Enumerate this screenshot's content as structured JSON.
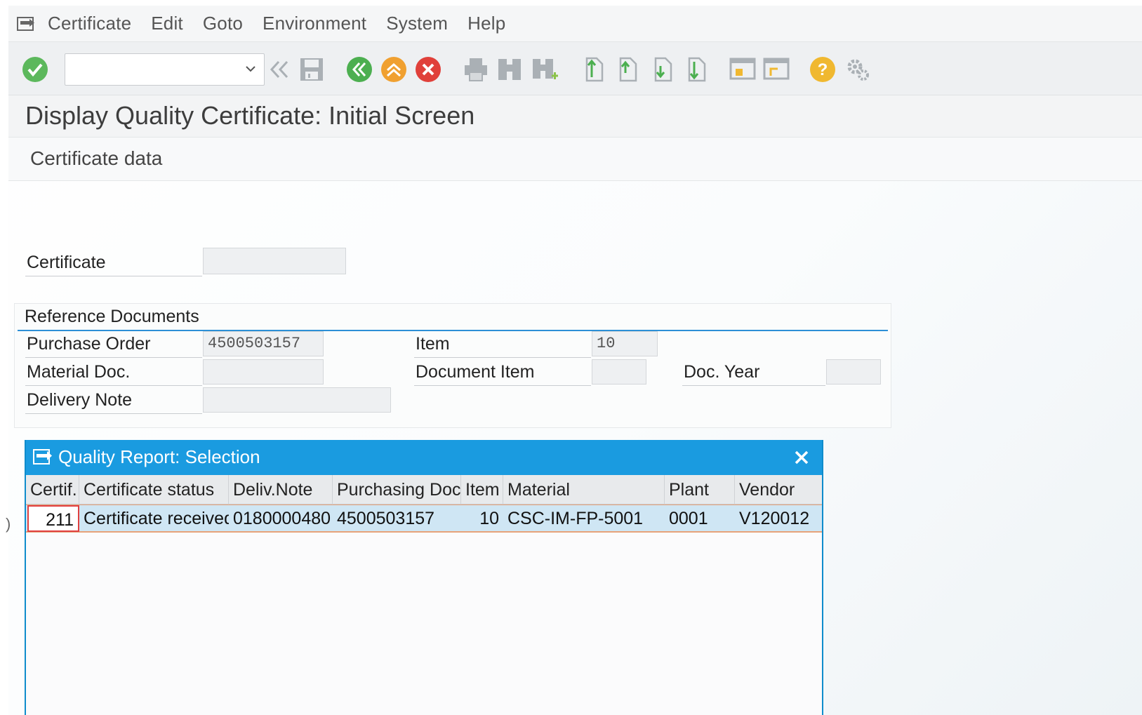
{
  "menu": {
    "items": [
      "Certificate",
      "Edit",
      "Goto",
      "Environment",
      "System",
      "Help"
    ]
  },
  "toolbar": {
    "command_value": "",
    "icons": [
      "enter-icon",
      "command-dropdown",
      "back-double-icon",
      "save-icon",
      "back-icon",
      "exit-icon",
      "cancel-icon",
      "print-icon",
      "find-icon",
      "find-next-icon",
      "first-page-icon",
      "previous-page-icon",
      "next-page-icon",
      "last-page-icon",
      "create-session-icon",
      "create-shortcut-icon",
      "help-icon",
      "customize-layout-icon"
    ],
    "colors": {
      "enter": "#5cb85c",
      "back": "#4caf50",
      "exit": "#f0a030",
      "cancel": "#e0403a",
      "help": "#f0b830"
    }
  },
  "page": {
    "title": "Display Quality Certificate: Initial Screen",
    "section": "Certificate data"
  },
  "form": {
    "certificate_label": "Certificate",
    "certificate_value": "",
    "reference_title": "Reference Documents",
    "purchase_order_label": "Purchase Order",
    "purchase_order_value": "4500503157",
    "item_label": "Item",
    "item_value": "10",
    "material_doc_label": "Material Doc.",
    "material_doc_value": "",
    "document_item_label": "Document Item",
    "document_item_value": "",
    "doc_year_label": "Doc. Year",
    "doc_year_value": "",
    "delivery_note_label": "Delivery Note",
    "delivery_note_value": ""
  },
  "popup": {
    "title": "Quality Report: Selection",
    "columns": [
      "Certif.",
      "Certificate status",
      "Deliv.Note",
      "Purchasing Doc.",
      "Item",
      "Material",
      "Plant",
      "Vendor"
    ],
    "rows": [
      [
        "211",
        "Certificate received",
        "0180000480",
        "4500503157",
        "10",
        "CSC-IM-FP-5001",
        "0001",
        "V120012"
      ]
    ],
    "header_color": "#1a9be0"
  }
}
